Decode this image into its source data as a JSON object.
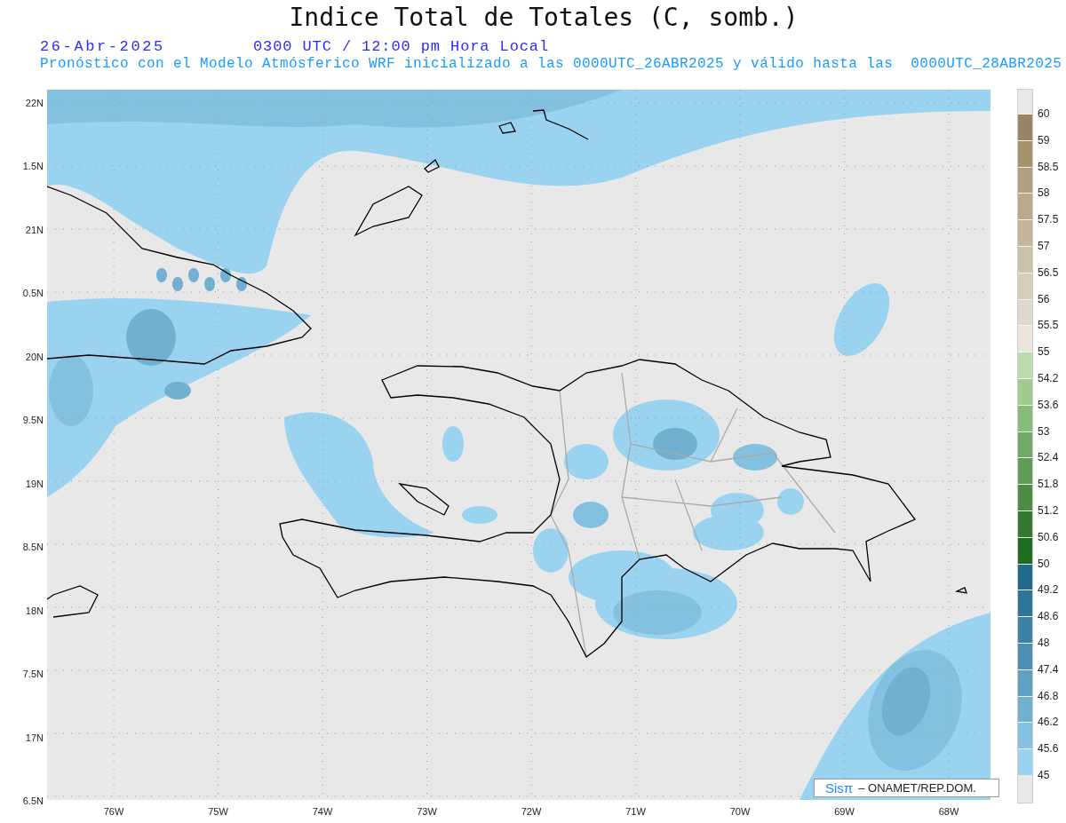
{
  "title": "Indice Total de Totales (C, somb.)",
  "date": "26-Abr-2025",
  "time": "0300 UTC / 12:00 pm Hora Local",
  "subtitle": "Pronóstico con el Modelo Atmósferico WRF inicializado a las 0000UTC_26ABR2025 y válido hasta las  0000UTC_28ABR2025",
  "map": {
    "lat_labels": [
      "22N",
      "1.5N",
      "21N",
      "0.5N",
      "20N",
      "9.5N",
      "19N",
      "8.5N",
      "18N",
      "7.5N",
      "17N",
      "6.5N"
    ],
    "lon_labels": [
      "76W",
      "75W",
      "74W",
      "73W",
      "72W",
      "71W",
      "70W",
      "69W",
      "68W"
    ]
  },
  "colorbar": {
    "labels": [
      "60",
      "59",
      "58.5",
      "58",
      "57.5",
      "57",
      "56.5",
      "56",
      "55.5",
      "55",
      "54.2",
      "53.6",
      "53",
      "52.4",
      "51.8",
      "51.2",
      "50.6",
      "50",
      "49.2",
      "48.6",
      "48",
      "47.4",
      "46.8",
      "46.2",
      "45.6",
      "45"
    ],
    "bins": [
      {
        "color": "#9a8462"
      },
      {
        "color": "#a8926e"
      },
      {
        "color": "#b1a07f"
      },
      {
        "color": "#bba98c"
      },
      {
        "color": "#c4b59c"
      },
      {
        "color": "#cdc1ab"
      },
      {
        "color": "#d7cdbb"
      },
      {
        "color": "#e0d9cb"
      },
      {
        "color": "#ebe6dc"
      },
      {
        "color": "#bcdcb0"
      },
      {
        "color": "#a1cb93"
      },
      {
        "color": "#89bb7b"
      },
      {
        "color": "#71a966"
      },
      {
        "color": "#5f9d57"
      },
      {
        "color": "#4b8d45"
      },
      {
        "color": "#35782f"
      },
      {
        "color": "#1f6b1f"
      },
      {
        "color": "#216a8e"
      },
      {
        "color": "#2f7499"
      },
      {
        "color": "#3f82a8"
      },
      {
        "color": "#4d8fb4"
      },
      {
        "color": "#5f9fc2"
      },
      {
        "color": "#72b0d2"
      },
      {
        "color": "#84c0e0"
      },
      {
        "color": "#9ad3f0"
      }
    ]
  },
  "credit": {
    "brand": "Sisπ",
    "text": "– ONAMET/REP.DOM."
  }
}
